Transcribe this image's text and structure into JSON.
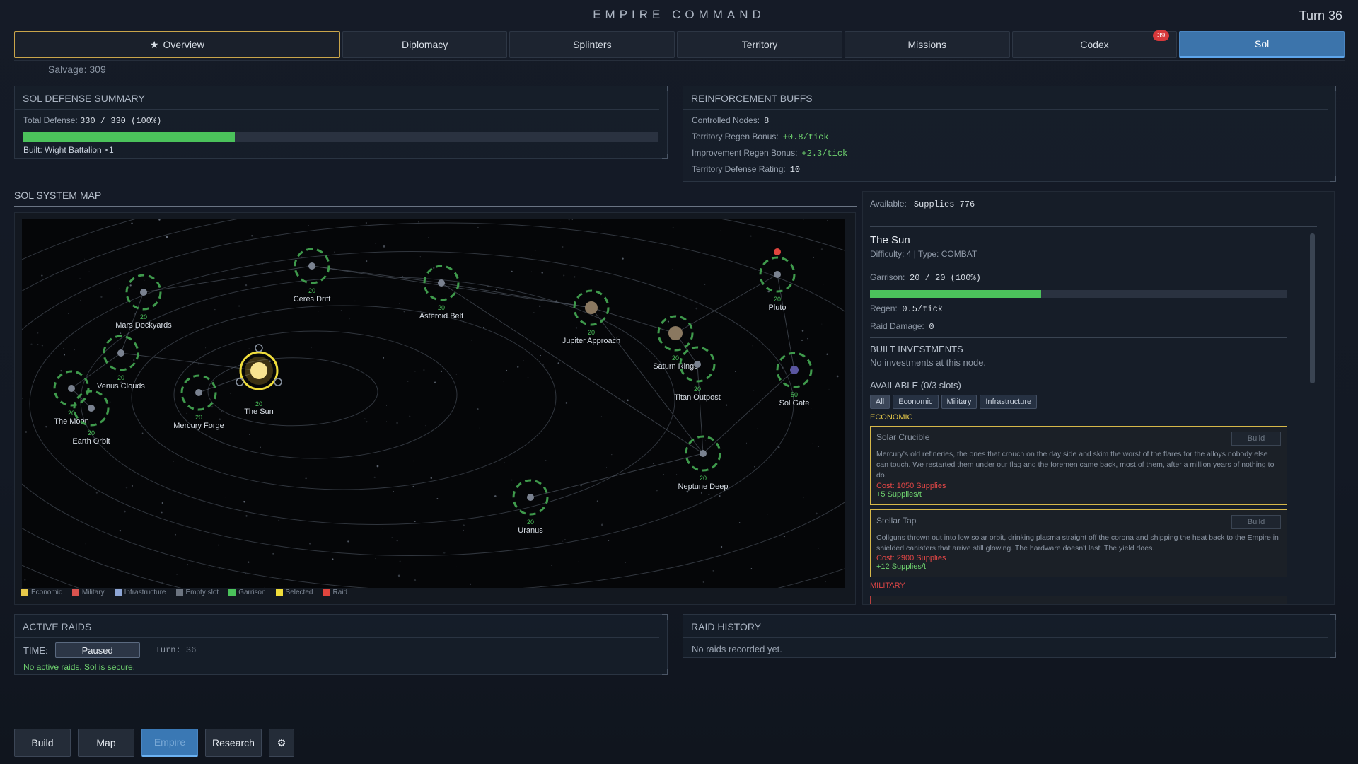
{
  "header": {
    "title": "EMPIRE COMMAND",
    "turn": "Turn 36"
  },
  "tabs": [
    {
      "label": "Overview",
      "icon": "star-icon"
    },
    {
      "label": "Diplomacy"
    },
    {
      "label": "Splinters"
    },
    {
      "label": "Territory"
    },
    {
      "label": "Missions"
    },
    {
      "label": "Codex",
      "badge": "39"
    },
    {
      "label": "Sol",
      "active": true
    }
  ],
  "salvage": "Salvage: 309",
  "defense": {
    "title": "SOL DEFENSE SUMMARY",
    "total_label": "Total Defense:",
    "total_value": "330 / 330 (100%)",
    "bar_fraction": 0.333,
    "built": "Built: Wight Battalion ×1"
  },
  "reinforcement": {
    "title": "REINFORCEMENT BUFFS",
    "rows": [
      {
        "label": "Controlled Nodes:",
        "value": "8",
        "green": false
      },
      {
        "label": "Territory Regen Bonus:",
        "value": "+0.8/tick",
        "green": true
      },
      {
        "label": "Improvement Regen Bonus:",
        "value": "+2.3/tick",
        "green": true
      },
      {
        "label": "Territory Defense Rating:",
        "value": "10",
        "green": false
      }
    ]
  },
  "map": {
    "title": "SOL SYSTEM MAP",
    "legend": [
      {
        "label": "Economic",
        "color": "#e7c94a"
      },
      {
        "label": "Military",
        "color": "#d9534f"
      },
      {
        "label": "Infrastructure",
        "color": "#8ea6d6"
      },
      {
        "label": "Empty slot",
        "color": "#6c7480"
      },
      {
        "label": "Garrison",
        "color": "#4bc25b"
      },
      {
        "label": "Selected",
        "color": "#f0dd3b"
      },
      {
        "label": "Raid",
        "color": "#e0453e"
      }
    ],
    "nodes": [
      {
        "name": "Mars Dockyards",
        "garrison": "20"
      },
      {
        "name": "Ceres Drift",
        "garrison": "20"
      },
      {
        "name": "Asteroid Belt",
        "garrison": "20"
      },
      {
        "name": "Jupiter Approach",
        "garrison": "20"
      },
      {
        "name": "Saturn Rings",
        "garrison": "20"
      },
      {
        "name": "Pluto",
        "garrison": "20"
      },
      {
        "name": "Venus Clouds",
        "garrison": "20"
      },
      {
        "name": "The Sun",
        "garrison": "20"
      },
      {
        "name": "Mercury Forge",
        "garrison": "20"
      },
      {
        "name": "The Moon",
        "garrison": "20"
      },
      {
        "name": "Earth Orbit",
        "garrison": "20"
      },
      {
        "name": "Titan Outpost",
        "garrison": "20"
      },
      {
        "name": "Sol Gate",
        "garrison": "50"
      },
      {
        "name": "Neptune Deep",
        "garrison": "20"
      },
      {
        "name": "Uranus",
        "garrison": "20"
      }
    ]
  },
  "side": {
    "available_label": "Available:",
    "available_value": "Supplies 776",
    "node_name": "The Sun",
    "node_meta": "Difficulty: 4 | Type: COMBAT",
    "garrison_label": "Garrison:",
    "garrison_value": "20 / 20 (100%)",
    "garrison_fraction": 0.41,
    "regen_label": "Regen:",
    "regen_value": "0.5/tick",
    "raid_label": "Raid Damage:",
    "raid_value": "0",
    "built_title": "BUILT INVESTMENTS",
    "built_empty": "No investments at this node.",
    "available_title": "AVAILABLE (0/3 slots)",
    "filters": [
      "All",
      "Economic",
      "Military",
      "Infrastructure"
    ],
    "economic_label": "ECONOMIC",
    "military_label": "MILITARY",
    "cards": [
      {
        "name": "Solar Crucible",
        "button": "Build",
        "desc": "Mercury's old refineries, the ones that crouch on the day side and skim the worst of the flares for the alloys nobody else can touch. We restarted them under our flag and the foremen came back, most of them, after a million years of nothing to do.",
        "cost": "Cost: 1050 Supplies",
        "yield": "+5 Supplies/t"
      },
      {
        "name": "Stellar Tap",
        "button": "Build",
        "desc": "Collguns thrown out into low solar orbit, drinking plasma straight off the corona and shipping the heat back to the Empire in shielded canisters that arrive still glowing. The hardware doesn't last. The yield does.",
        "cost": "Cost: 2900 Supplies",
        "yield": "+12 Supplies/t"
      }
    ]
  },
  "raids": {
    "title": "ACTIVE RAIDS",
    "time_label": "TIME:",
    "time_button": "Paused",
    "turn": "Turn: 36",
    "status": "No active raids. Sol is secure."
  },
  "history": {
    "title": "RAID HISTORY",
    "empty": "No raids recorded yet."
  },
  "bottom": [
    "Build",
    "Map",
    "Empire",
    "Research"
  ]
}
